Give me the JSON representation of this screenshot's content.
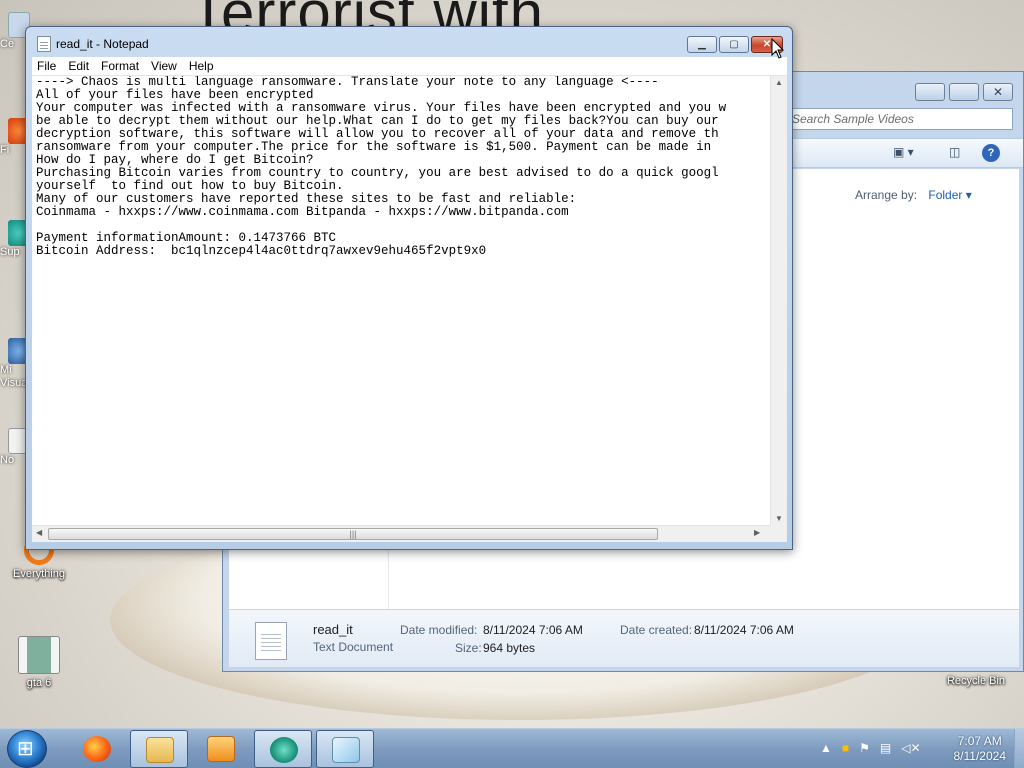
{
  "wallpaper": {
    "headline": "Terrorist with"
  },
  "desktop_icons": [
    {
      "label": "Ce",
      "name": "desktop-icon-partial-1"
    },
    {
      "label": "Fi",
      "name": "desktop-icon-partial-2"
    },
    {
      "label": "Sup",
      "name": "desktop-icon-partial-3"
    },
    {
      "label": "Mi Visua",
      "name": "desktop-icon-partial-4"
    },
    {
      "label": "No",
      "name": "desktop-icon-partial-5"
    },
    {
      "label": "Everything",
      "name": "desktop-icon-everything"
    },
    {
      "label": "gta 6",
      "name": "desktop-icon-gta6"
    },
    {
      "label": "Recycle Bin",
      "name": "desktop-icon-recycle-bin"
    }
  ],
  "notepad": {
    "title": "read_it - Notepad",
    "menu": [
      "File",
      "Edit",
      "Format",
      "View",
      "Help"
    ],
    "content": "----> Chaos is multi language ransomware. Translate your note to any language <----\nAll of your files have been encrypted\nYour computer was infected with a ransomware virus. Your files have been encrypted and you w\nbe able to decrypt them without our help.What can I do to get my files back?You can buy our\ndecryption software, this software will allow you to recover all of your data and remove th\nransomware from your computer.The price for the software is $1,500. Payment can be made in\nHow do I pay, where do I get Bitcoin?\nPurchasing Bitcoin varies from country to country, you are best advised to do a quick googl\nyourself  to find out how to buy Bitcoin.\nMany of our customers have reported these sites to be fast and reliable:\nCoinmama - hxxps://www.coinmama.com Bitpanda - hxxps://www.bitpanda.com\n\nPayment informationAmount: 0.1473766 BTC\nBitcoin Address:  bc1qlnzcep4l4ac0ttdrq7awxev9ehu465f2vpt9x0"
  },
  "explorer": {
    "search_placeholder": "Search Sample Videos",
    "arrange_label": "Arrange by:",
    "arrange_value": "Folder",
    "details": {
      "file_name": "read_it",
      "file_type": "Text Document",
      "modified_label": "Date modified:",
      "modified_value": "8/11/2024 7:06 AM",
      "created_label": "Date created:",
      "created_value": "8/11/2024 7:06 AM",
      "size_label": "Size:",
      "size_value": "964 bytes"
    }
  },
  "taskbar": {
    "time": "7:07 AM",
    "date": "8/11/2024",
    "apps": [
      "Firefox",
      "Windows Explorer",
      "Windows Media Player",
      "Task Manager",
      "Notepad"
    ]
  },
  "colors": {
    "taskbar": "#7f9cbf",
    "window_frame": "#b7cde6",
    "close_button": "#c7452b",
    "link_blue": "#1b5fb0"
  }
}
